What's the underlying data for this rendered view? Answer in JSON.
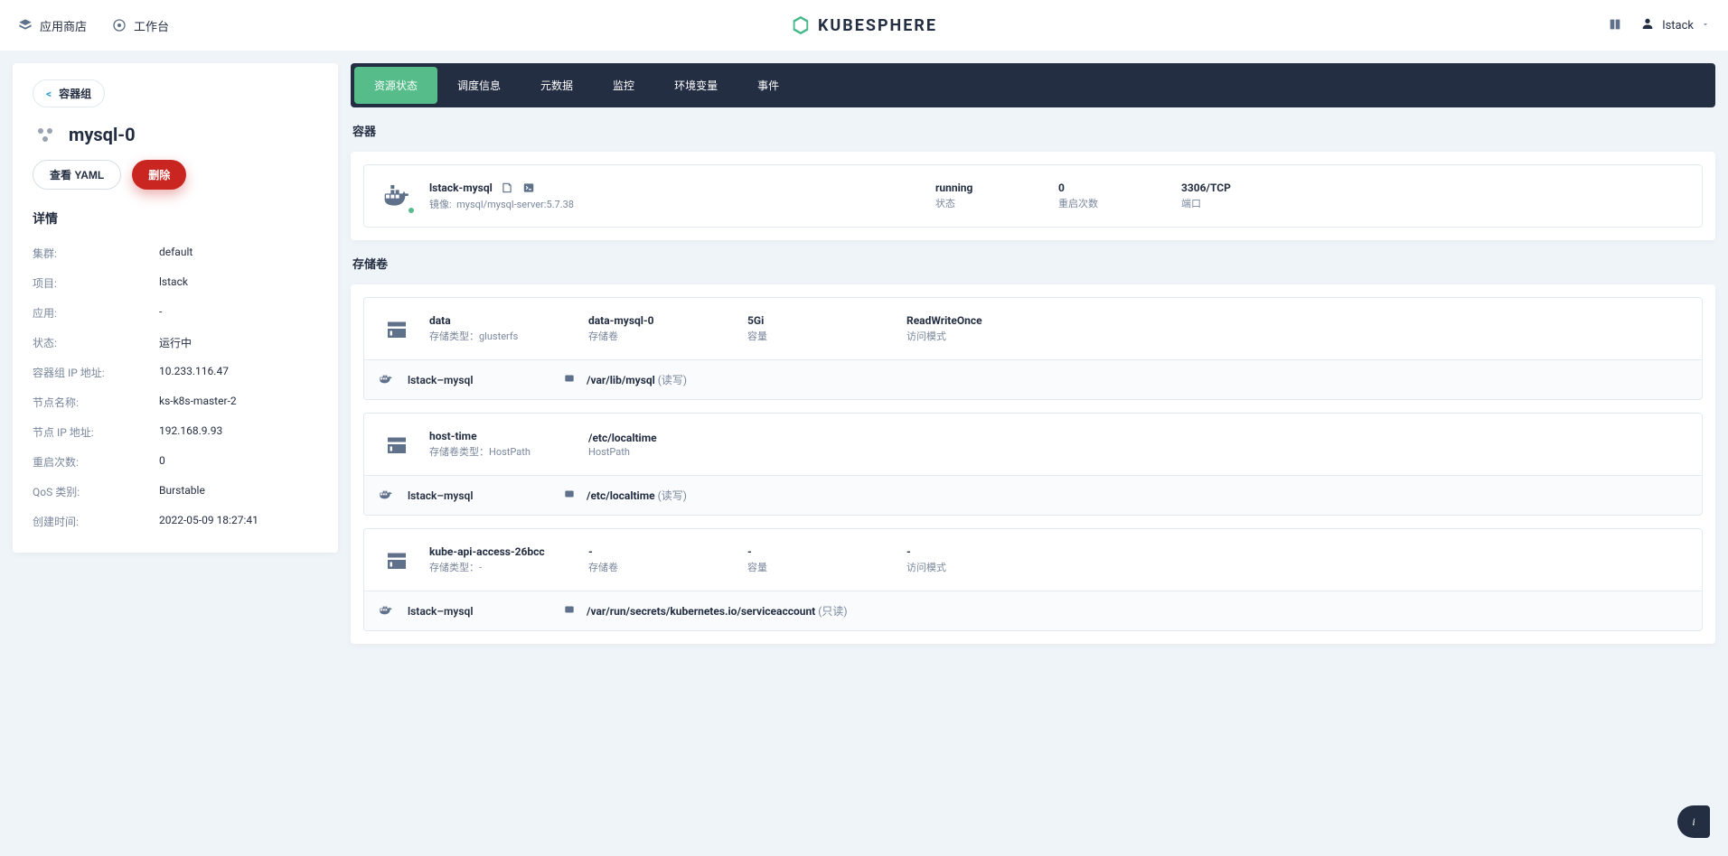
{
  "topbar": {
    "appstore": "应用商店",
    "workbench": "工作台",
    "brand": "KUBESPHERE",
    "username": "lstack"
  },
  "sidebar": {
    "back_label": "容器组",
    "title": "mysql-0",
    "btn_yaml": "查看 YAML",
    "btn_delete": "删除",
    "detail_header": "详情",
    "rows": [
      {
        "k": "集群:",
        "v": "default"
      },
      {
        "k": "项目:",
        "v": "lstack"
      },
      {
        "k": "应用:",
        "v": "-"
      },
      {
        "k": "状态:",
        "v": "运行中"
      },
      {
        "k": "容器组 IP 地址:",
        "v": "10.233.116.47"
      },
      {
        "k": "节点名称:",
        "v": "ks-k8s-master-2"
      },
      {
        "k": "节点 IP 地址:",
        "v": "192.168.9.93"
      },
      {
        "k": "重启次数:",
        "v": "0"
      },
      {
        "k": "QoS 类别:",
        "v": "Burstable"
      },
      {
        "k": "创建时间:",
        "v": "2022-05-09 18:27:41"
      }
    ]
  },
  "tabs": [
    "资源状态",
    "调度信息",
    "元数据",
    "监控",
    "环境变量",
    "事件"
  ],
  "sections": {
    "containers_title": "容器",
    "volumes_title": "存储卷"
  },
  "container": {
    "name": "lstack-mysql",
    "image_label": "镜像:",
    "image_value": "mysql/mysql-server:5.7.38",
    "status_v": "running",
    "status_k": "状态",
    "restart_v": "0",
    "restart_k": "重启次数",
    "port_v": "3306/TCP",
    "port_k": "端口"
  },
  "volumes": [
    {
      "name": "data",
      "type_label": "存储类型：",
      "type_value": "glusterfs",
      "pvc_v": "data-mysql-0",
      "pvc_k": "存储卷",
      "size_v": "5Gi",
      "size_k": "容量",
      "mode_v": "ReadWriteOnce",
      "mode_k": "访问模式",
      "mount_container": "lstack–mysql",
      "mount_path": "/var/lib/mysql",
      "mount_mode": "(读写)"
    },
    {
      "name": "host-time",
      "type_label": "存储卷类型：",
      "type_value": "HostPath",
      "pvc_v": "/etc/localtime",
      "pvc_k": "HostPath",
      "size_v": "",
      "size_k": "",
      "mode_v": "",
      "mode_k": "",
      "mount_container": "lstack–mysql",
      "mount_path": "/etc/localtime",
      "mount_mode": "(读写)"
    },
    {
      "name": "kube-api-access-26bcc",
      "type_label": "存储类型：",
      "type_value": "-",
      "pvc_v": "-",
      "pvc_k": "存储卷",
      "size_v": "-",
      "size_k": "容量",
      "mode_v": "-",
      "mode_k": "访问模式",
      "mount_container": "lstack–mysql",
      "mount_path": "/var/run/secrets/kubernetes.io/serviceaccount",
      "mount_mode": "(只读)"
    }
  ]
}
